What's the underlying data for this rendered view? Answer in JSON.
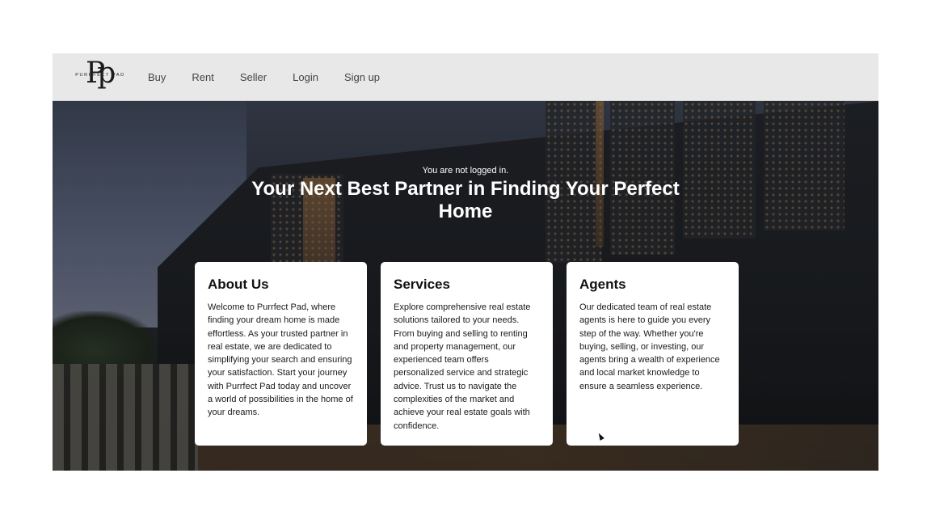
{
  "brand": {
    "logo_text": "PURRFECT PAD",
    "logo_mark": "Pp"
  },
  "nav": {
    "items": [
      {
        "label": "Buy"
      },
      {
        "label": "Rent"
      },
      {
        "label": "Seller"
      },
      {
        "label": "Login"
      },
      {
        "label": "Sign up"
      }
    ]
  },
  "hero": {
    "status": "You are not logged in.",
    "title": "Your Next Best Partner in Finding Your Perfect Home"
  },
  "cards": [
    {
      "title": "About Us",
      "body": "Welcome to Purrfect Pad, where finding your dream home is made effortless. As your trusted partner in real estate, we are dedicated to simplifying your search and ensuring your satisfaction. Start your journey with Purrfect Pad today and uncover a world of possibilities in the home of your dreams."
    },
    {
      "title": "Services",
      "body": "Explore comprehensive real estate solutions tailored to your needs. From buying and selling to renting and property management, our experienced team offers personalized service and strategic advice. Trust us to navigate the complexities of the market and achieve your real estate goals with confidence."
    },
    {
      "title": "Agents",
      "body": "Our dedicated team of real estate agents is here to guide you every step of the way. Whether you're buying, selling, or investing, our agents bring a wealth of experience and local market knowledge to ensure a seamless experience."
    }
  ],
  "colors": {
    "navbar_bg": "#e8e8e8",
    "card_bg": "#ffffff",
    "hero_text": "#ffffff"
  }
}
